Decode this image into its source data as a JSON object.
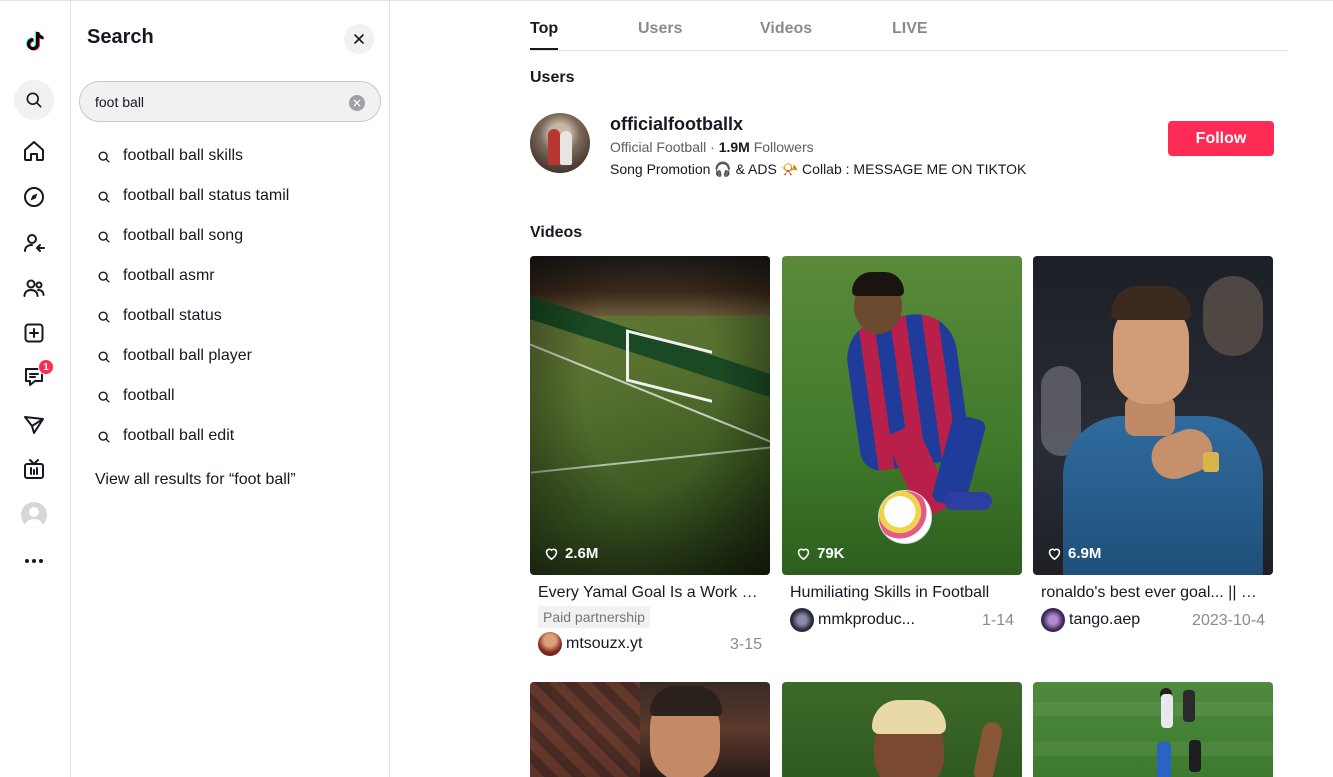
{
  "sidebar": {
    "icons": [
      "tiktok-logo-icon",
      "search-icon",
      "home-icon",
      "explore-icon",
      "following-icon",
      "friends-icon",
      "upload-icon",
      "messages-icon",
      "activity-icon",
      "live-icon",
      "profile-avatar",
      "more-icon"
    ],
    "messages_badge": "1"
  },
  "search_panel": {
    "title": "Search",
    "query": "foot ball",
    "suggestions": [
      "football ball skills",
      "football ball status tamil",
      "football ball song",
      "football asmr",
      "football status",
      "football ball player",
      "football",
      "football ball edit"
    ],
    "view_all": "View all results for “foot ball”"
  },
  "tabs": [
    "Top",
    "Users",
    "Videos",
    "LIVE"
  ],
  "active_tab": "Top",
  "users_section": {
    "title": "Users",
    "user": {
      "handle": "officialfootballx",
      "name": "Official Football",
      "separator": " · ",
      "followers_count": "1.9M",
      "followers_label": " Followers",
      "bio": "Song Promotion 🎧 & ADS 📯 Collab : MESSAGE ME ON TIKTOK",
      "follow_label": "Follow"
    }
  },
  "videos_section": {
    "title": "Videos",
    "videos": [
      {
        "likes": "2.6M",
        "title": "Every Yamal Goal Is a Work …",
        "paid": "Paid partnership",
        "author": "mtsouzx.yt",
        "date": "3-15"
      },
      {
        "likes": "79K",
        "title": "Humiliating Skills in Football",
        "author": "mmkproduc...",
        "date": "1-14"
      },
      {
        "likes": "6.9M",
        "title": "ronaldo's best ever goal... || …",
        "author": "tango.aep",
        "date": "2023-10-4"
      }
    ]
  },
  "colors": {
    "accent": "#fe2c55",
    "text": "#161823",
    "muted": "#8a8b91"
  }
}
